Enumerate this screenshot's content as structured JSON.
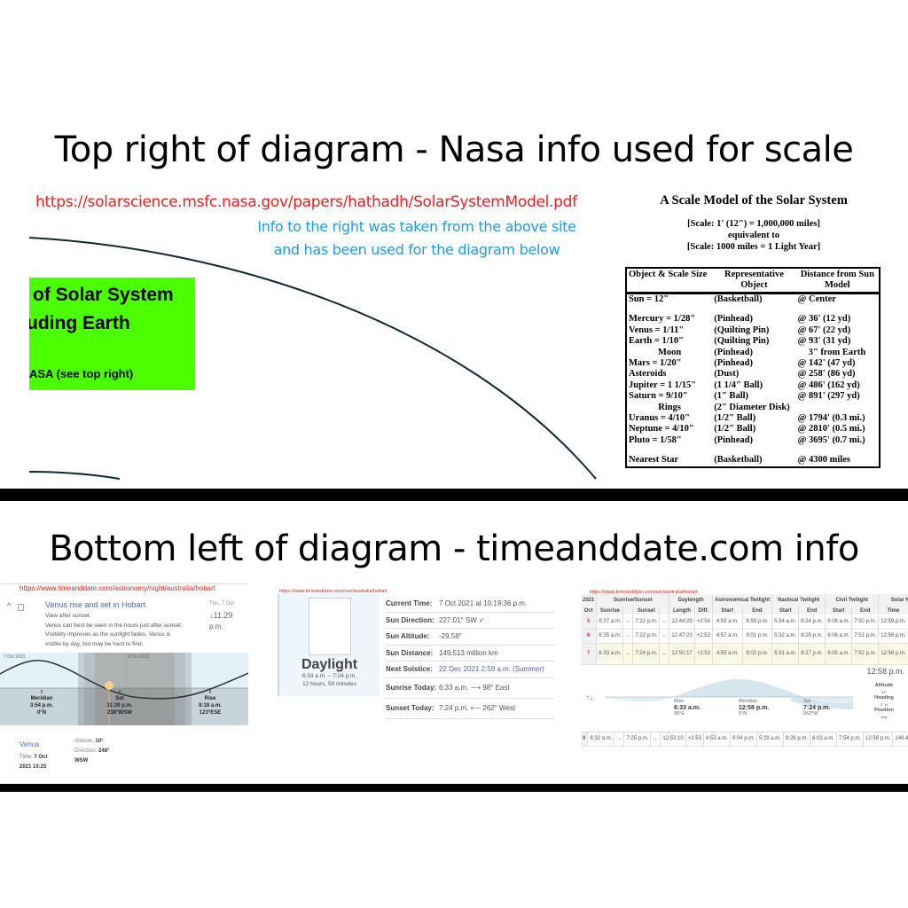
{
  "top_section": {
    "heading": "Top right of diagram - Nasa info used for scale",
    "nasa_url": "https://solarscience.msfc.nasa.gov/papers/hathadh/SolarSystemModel.pdf",
    "info_line1": "Info to the right was taken from the above site",
    "info_line2": "and has been used for the diagram below",
    "green_box": {
      "line1": "of Solar System",
      "line2": "uding Earth",
      "line3": "ASA (see top right)",
      "color": "#4cff00"
    },
    "scale_model": {
      "title": "A Scale Model of the Solar System",
      "scale1": "[Scale: 1' (12\") = 1,000,000 miles]",
      "equivalent": "equivalent to",
      "scale2": "[Scale: 1000 miles = 1 Light Year]",
      "headers": [
        "Object & Scale Size",
        "Representative Object",
        "Distance from Sun Model"
      ],
      "rows": [
        [
          "Sun = 12\"",
          "(Basketball)",
          "@ Center"
        ],
        [
          "",
          "",
          ""
        ],
        [
          "Mercury = 1/28\"",
          "(Pinhead)",
          "@ 36' (12 yd)"
        ],
        [
          "Venus = 1/11\"",
          "(Quilting Pin)",
          "@ 67' (22 yd)"
        ],
        [
          "Earth = 1/10\"",
          "(Quilting Pin)",
          "@ 93' (31 yd)"
        ],
        [
          "Moon",
          "(Pinhead)",
          "3\" from Earth"
        ],
        [
          "Mars = 1/20\"",
          "(Pinhead)",
          "@ 142' (47 yd)"
        ],
        [
          "Asteroids",
          "(Dust)",
          "@ 258' (86 yd)"
        ],
        [
          "Jupiter = 1 1/15\"",
          "(1 1/4\" Ball)",
          "@ 486' (162 yd)"
        ],
        [
          "Saturn = 9/10\"",
          "(1\" Ball)",
          "@ 891' (297 yd)"
        ],
        [
          "Rings",
          "(2\" Diameter Disk)",
          ""
        ],
        [
          "Uranus = 4/10\"",
          "(1/2\" Ball)",
          "@ 1794' (0.3 mi.)"
        ],
        [
          "Neptune = 4/10\"",
          "(1/2\" Ball)",
          "@ 2810' (0.5 mi.)"
        ],
        [
          "Pluto = 1/58\"",
          "(Pinhead)",
          "@ 3695' (0.7 mi.)"
        ],
        [
          "",
          "",
          ""
        ],
        [
          "Nearest Star",
          "(Basketball)",
          "@ 4300 miles"
        ]
      ]
    }
  },
  "bottom_section": {
    "heading": "Bottom left of diagram - timeanddate.com info",
    "venus": {
      "url": "https://www.timeanddate.com/astronomy/night/australia/hobart",
      "title": "Venus rise and set in Hobart",
      "desc1": "View after sunset.",
      "desc2": "Venus can best be seen in the hours just after sunset.",
      "desc3": "Visibility improves as the sunlight fades. Venus is",
      "desc4": "visible by day, but may be hard to find.",
      "date_small": "Thu, 7 Oct",
      "time_big": "↓11:29",
      "time_pm": "p.m.",
      "chart_date1": "7 Oct 2021",
      "chart_date2": "8 Oct 2021",
      "events": [
        {
          "name": "Meridian",
          "time": "3:54 p.m.",
          "dir": "0°N"
        },
        {
          "name": "Set",
          "time": "11:29 p.m.",
          "dir": "238°WSW"
        },
        {
          "name": "Rise",
          "time": "8:18 a.m.",
          "dir": "123°ESE"
        }
      ],
      "planet": "Venus",
      "time_label": "Time:",
      "time_value1": "7 Oct",
      "time_value2": "2021 10:25",
      "altitude_label": "Altitude:",
      "altitude_value": "10°",
      "direction_label": "Direction:",
      "direction_value": "248°",
      "direction_compass": "WSW"
    },
    "sun": {
      "url": "https://www.timeanddate.com/sun/australia/hobart",
      "daylight_title": "Daylight",
      "daylight_range": "6:33 a.m. – 7:24 p.m.",
      "daylight_length": "12 hours, 50 minutes",
      "rows": [
        {
          "k": "Current Time:",
          "v": "7 Oct 2021 at 10:19:36 p.m."
        },
        {
          "k": "Sun Direction:",
          "v": "227.01° SW ✓"
        },
        {
          "k": "Sun Altitude:",
          "v": "-29.58°"
        },
        {
          "k": "Sun Distance:",
          "v": "149.513 million km"
        },
        {
          "k": "Next Solstice:",
          "v": "22 Dec 2021 2:59 a.m. (Summer)"
        },
        {
          "k": "Sunrise Today:",
          "v": "6:33 a.m. ⟶ 98° East"
        },
        {
          "k": "Sunset Today:",
          "v": "7:24 p.m. ⟵ 262° West"
        }
      ]
    },
    "sun_table": {
      "url": "https://www.timeanddate.com/sun/australia/hobart",
      "group_headers": [
        "2021",
        "Sunrise/Sunset",
        "Daylength",
        "Astronomical Twilight",
        "Nautical Twilight",
        "Civil Twilight",
        "Solar Noon"
      ],
      "headers": [
        "Oct",
        "Sunrise",
        "",
        "Sunset",
        "",
        "Length",
        "Diff.",
        "Start",
        "End",
        "Start",
        "End",
        "Start",
        "End",
        "Time",
        "Mil. km"
      ],
      "rows": [
        [
          "5",
          "6:37 a.m.",
          "→",
          "7:21 p.m.",
          "←",
          "12:44:29",
          "+2:54",
          "4:59 a.m.",
          "8:59 p.m.",
          "5:34 a.m.",
          "8:24 p.m.",
          "6:08 a.m.",
          "7:50 p.m.",
          "12:59 p.m.",
          "149.616"
        ],
        [
          "6",
          "6:35 a.m.",
          "→",
          "7:22 p.m.",
          "←",
          "12:47:23",
          "+2:53",
          "4:57 a.m.",
          "9:01 p.m.",
          "5:32 a.m.",
          "8:25 p.m.",
          "6:06 a.m.",
          "7:51 p.m.",
          "12:58 p.m.",
          "149.573"
        ],
        [
          "7",
          "6:33 a.m.",
          "→",
          "7:24 p.m.",
          "←",
          "12:50:17",
          "+2:53",
          "4:55 a.m.",
          "9:02 p.m.",
          "5:31 a.m.",
          "8:27 p.m.",
          "6:05 a.m.",
          "7:52 p.m.",
          "12:58 p.m.",
          "149.530"
        ]
      ],
      "last_row": [
        "8",
        "6:32 a.m.",
        "→",
        "7:25 p.m.",
        "←",
        "12:53:10",
        "+2:53",
        "4:53 a.m.",
        "9:04 p.m.",
        "5:29 a.m.",
        "8:28 p.m.",
        "6:03 a.m.",
        "7:54 p.m.",
        "12:58 p.m.",
        "149.487"
      ],
      "events": [
        {
          "name": "Rise",
          "time": "6:33 a.m.",
          "dir": "98°E"
        },
        {
          "name": "Meridian",
          "time": "12:58 p.m.",
          "dir": "0°N"
        },
        {
          "name": "Set",
          "time": "7:24 p.m.",
          "dir": "262°W"
        }
      ],
      "noon_time": "12:58 p.m.",
      "altitude_label": "Altitude",
      "altitude_value": "53°",
      "heading_label": "Heading",
      "heading_value": "0°",
      "heading_dir": "N",
      "position_label": "Position",
      "position_value": "Day",
      "updown_icon": "↑↓"
    }
  }
}
